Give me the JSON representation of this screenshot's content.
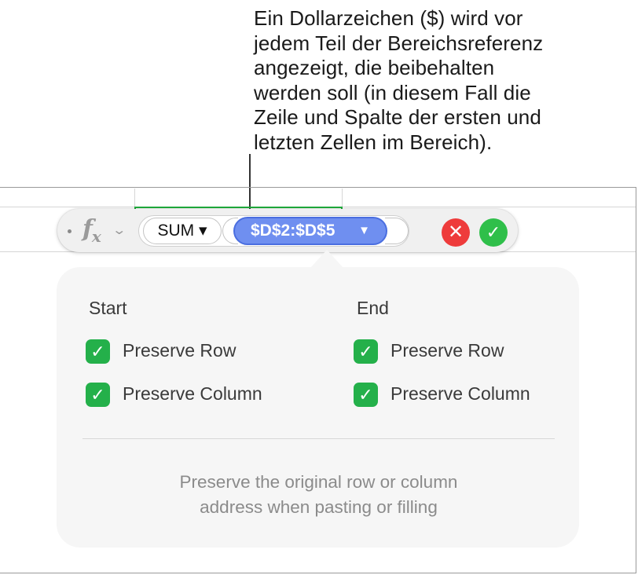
{
  "callout": {
    "text": "Ein Dollarzeichen ($) wird vor\njedem Teil der Bereichsreferenz\nangezeigt, die beibehalten\nwerden soll (in diesem Fall die\nZeile und Spalte der ersten und\nletzten Zellen im Bereich)."
  },
  "formula_editor": {
    "fx_label": "f",
    "fx_sub": "x",
    "chevron": "⌄",
    "function_token": "SUM ▾",
    "range_reference": "$D$2:$D$5",
    "range_arrow": "▼",
    "cancel_icon": "✕",
    "accept_icon": "✓"
  },
  "popover": {
    "start_heading": "Start",
    "end_heading": "End",
    "start_options": [
      {
        "label": "Preserve Row",
        "checked": true
      },
      {
        "label": "Preserve Column",
        "checked": true
      }
    ],
    "end_options": [
      {
        "label": "Preserve Row",
        "checked": true
      },
      {
        "label": "Preserve Column",
        "checked": true
      }
    ],
    "checkmark": "✓",
    "note": "Preserve the original row or column\naddress when pasting or filling"
  },
  "colors": {
    "accent_blue": "#6f8ff0",
    "checkbox_green": "#24b04a",
    "cancel_red": "#ee3b3b",
    "accept_green": "#2fbf4a",
    "cell_selection_green": "#1faa3c"
  }
}
